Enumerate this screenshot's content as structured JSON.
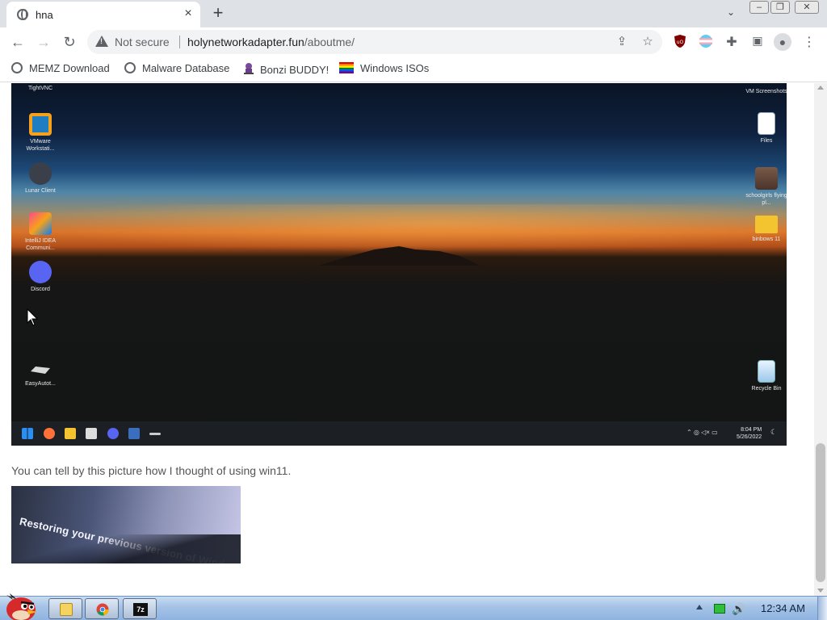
{
  "browser": {
    "tab_title": "hna",
    "tab_close": "×",
    "new_tab": "+",
    "tab_search": "⌄",
    "window_controls": {
      "minimize": "–",
      "restore": "❐",
      "close": "✕"
    }
  },
  "toolbar": {
    "back": "←",
    "forward": "→",
    "reload": "↻",
    "security_label": "Not secure",
    "url_host": "holynetworkadapter.fun",
    "url_path": "/aboutme/",
    "share_icon": "⇪",
    "bookmark_star": "☆",
    "extensions": [
      "uBlock Origin",
      "Transgender flag extension",
      "Extensions"
    ],
    "side_panel": "▣",
    "profile": "●",
    "menu": "⋮"
  },
  "bookmarks": [
    {
      "label": "MEMZ Download",
      "icon": "globe-icon"
    },
    {
      "label": "Malware Database",
      "icon": "globe-icon"
    },
    {
      "label": "Bonzi BUDDY!",
      "icon": "bonzi-icon"
    },
    {
      "label": "Windows ISOs",
      "icon": "rainbow-flag-icon"
    }
  ],
  "screenshot1": {
    "left_icons": [
      "TightVNC",
      "VMware Workstati...",
      "Lunar Client",
      "IntelliJ IDEA Communi...",
      "Discord",
      "EasyAutot..."
    ],
    "right_icons": [
      "VM Screenshots",
      "Files",
      "schoolgirls flying pl...",
      "binbows 11",
      "Recycle Bin"
    ],
    "clock_time": "8:04 PM",
    "clock_date": "5/26/2022"
  },
  "caption": "You can tell by this picture how I thought of using win11.",
  "screenshot2": {
    "text": "Restoring your previous version of Windows..."
  },
  "os_taskbar": {
    "clock": "12:34 AM",
    "chrome_icon": "chrome-icon",
    "sevenzip_label": "7z"
  }
}
